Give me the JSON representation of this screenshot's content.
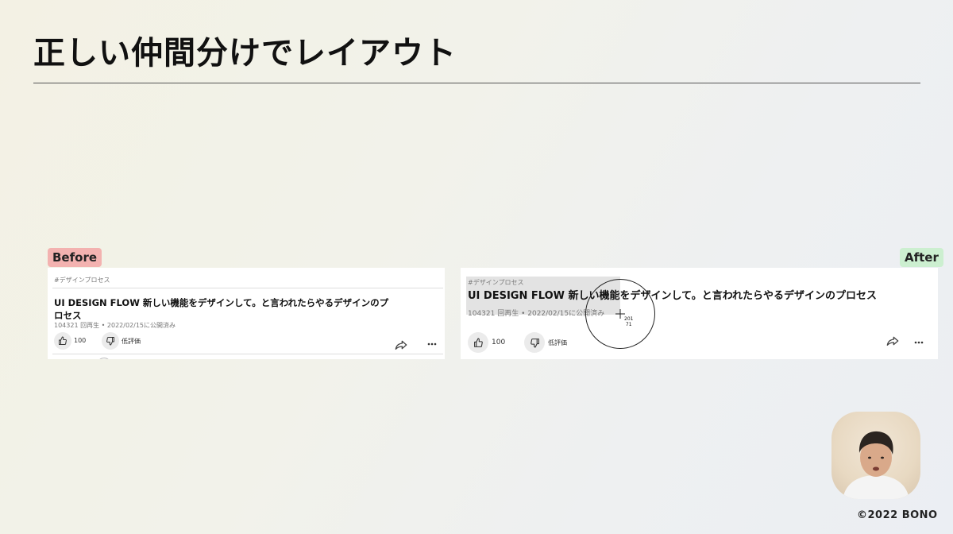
{
  "slide": {
    "title": "正しい仲間分けでレイアウト",
    "copyright": "©2022 BONO"
  },
  "before": {
    "tag": "Before",
    "hashtag": "#デザインプロセス",
    "video_title": "UI DESIGN FLOW 新しい機能をデザインして。と言われたらやるデザインのプロセス",
    "meta": "104321 回再生 • 2022/02/15に公開済み",
    "like_count": "100",
    "dislike_label": "低評価"
  },
  "after": {
    "tag": "After",
    "hashtag": "#デザインプロセス",
    "video_title": "UI DESIGN FLOW 新しい機能をデザインして。と言われたらやるデザインのプロセス",
    "meta": "104321 回再生 • 2022/02/15に公開済み",
    "like_count": "100",
    "dislike_label": "低評価"
  },
  "cursor": {
    "readout_x": "201",
    "readout_y": "71"
  },
  "icons": {
    "like": "thumbs-up-icon",
    "dislike": "thumbs-down-icon",
    "share": "share-arrow-icon",
    "more": "more-horizontal-icon",
    "crosshair": "crosshair-icon"
  },
  "colors": {
    "before_tag": "#f3b2b0",
    "after_tag": "#ccefd0",
    "panel_bg": "#ffffff",
    "button_bg": "#ebebeb",
    "grouping_highlight": "#e3e3e3"
  }
}
